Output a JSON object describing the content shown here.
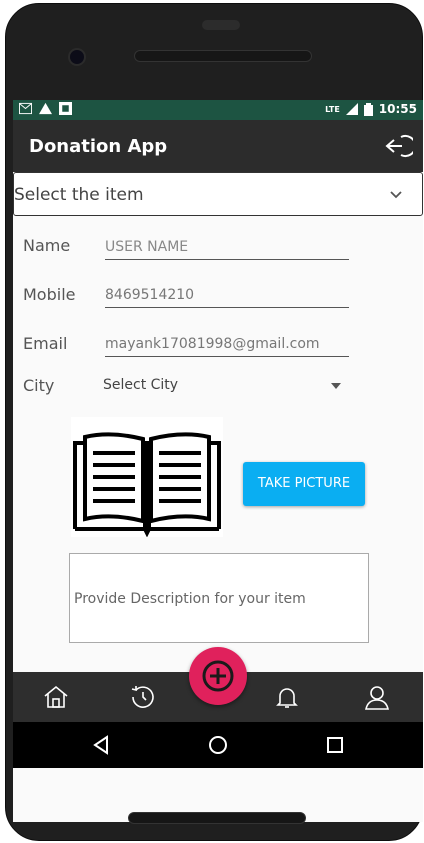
{
  "status": {
    "network": "LTE",
    "time": "10:55"
  },
  "appbar": {
    "title": "Donation App",
    "logout_icon": "logout-icon"
  },
  "item_select": {
    "value": "Select the item"
  },
  "form": {
    "name_label": "Name",
    "name_placeholder": "USER NAME",
    "mobile_label": "Mobile",
    "mobile_value": "8469514210",
    "email_label": "Email",
    "email_value": "mayank17081998@gmail.com",
    "city_label": "City",
    "city_value": "Select City"
  },
  "picture": {
    "button_label": "TAKE PICTURE",
    "image_icon": "open-book-icon"
  },
  "description": {
    "placeholder": "Provide Description for your item"
  },
  "bottom_nav": {
    "items": [
      "home-icon",
      "history-icon",
      "add-icon",
      "bell-icon",
      "profile-icon"
    ]
  },
  "colors": {
    "status_bar": "#1d5442",
    "app_bar": "#2c2c2c",
    "accent": "#0aaef2",
    "fab": "#e0215c"
  }
}
